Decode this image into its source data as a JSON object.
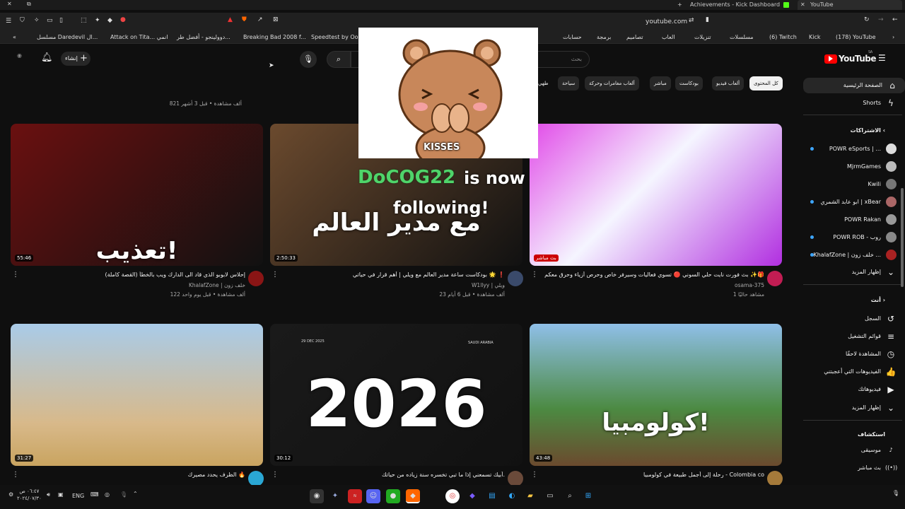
{
  "browser": {
    "tabs": [
      {
        "label": "Achievements - Kick Dashboard"
      },
      {
        "label": "YouTube"
      }
    ],
    "url": "youtube.com",
    "bookmarks": [
      "(178) YouTube",
      "Kick",
      "(6) Twitch",
      "مسلسلات",
      "تنزيلات",
      "العاب",
      "تصاميم",
      "برمجة",
      "حسابات",
      "Speedtest by Ookla",
      "Breaking Bad 2008 f...",
      "دوولينجو - أفضل طر...",
      "Attack on Tita... انمي",
      "مسلسل Daredevil ال..."
    ]
  },
  "header": {
    "logo": "YouTube",
    "logo_region": "SA",
    "search_placeholder": "بحث",
    "create_label": "إنشاء"
  },
  "chips": [
    "كل المحتوى",
    "ألعاب فيديو",
    "بودكاست",
    "مباشر",
    "ألعاب مغامرات وحركة",
    "سياحة",
    "طهي"
  ],
  "overlay": {
    "sticker_caption": "KISSES",
    "follow_name": "DoCOG22",
    "follow_text1": "is now",
    "follow_text2": "following!"
  },
  "sidebar": {
    "home": "الصفحة الرئيسية",
    "shorts": "Shorts",
    "subscriptions_title": "الاشتراكات",
    "subscriptions": [
      {
        "name": "POWR eSports | ...",
        "dot": true
      },
      {
        "name": "MjrmGames",
        "dot": false
      },
      {
        "name": "Kwili",
        "dot": false
      },
      {
        "name": "ابو عابد الشمري | xBear",
        "dot": true
      },
      {
        "name": "POWR Rakan",
        "dot": false
      },
      {
        "name": "POWR ROB - روب",
        "dot": true
      },
      {
        "name": "KhalafZone | خلف زون ...",
        "dot": true
      }
    ],
    "show_more": "إظهار المزيد",
    "you_title": "أنت",
    "you_items": [
      {
        "label": "السجل",
        "icon": "history-icon",
        "glyph": "↺"
      },
      {
        "label": "قوائم التشغيل",
        "icon": "playlists-icon",
        "glyph": "≡"
      },
      {
        "label": "المشاهدة لاحقًا",
        "icon": "clock-icon",
        "glyph": "◷"
      },
      {
        "label": "الفيديوهات التي أعجبتني",
        "icon": "like-icon",
        "glyph": "👍"
      },
      {
        "label": "فيديوهاتك",
        "icon": "your-videos-icon",
        "glyph": "▶"
      }
    ],
    "show_more2": "إظهار المزيد",
    "explore_title": "استكشاف",
    "explore_items": [
      {
        "label": "موسيقى",
        "icon": "music-icon",
        "glyph": "♪"
      },
      {
        "label": "بث مباشر",
        "icon": "live-icon",
        "glyph": "((•))"
      }
    ]
  },
  "top_meta": "821 ألف مشاهدة • قبل 3 أشهر",
  "videos": [
    {
      "title": "بث فورت نايت حلي السوني 🔴 تسوي فعاليات وسيرفر خاص وحرص أزياء وحرق معكم ✨🎁",
      "channel": "osama-375",
      "meta": "1 مشاهد حاليًا",
      "duration": "بث مباشر",
      "thumb_color": "#b23ad0",
      "avatar_color": "#c21d53"
    },
    {
      "title": "بودكاست ساعة مدير العالم مع ويلي | أهم قرار في حياتي 🌟 ❗",
      "channel": "W1llyy | ويلي",
      "meta": "23 ألف مشاهدة • قبل 6 أيام",
      "duration": "2:50:33",
      "thumb_color": "#6b4a2e",
      "avatar_color": "#3a4a6a",
      "thumb_text": "مع مدير العالم"
    },
    {
      "title": "إحلاس لابوبو الذي قاد الى الدارك ويب بالخطأ (القصة كاملة)",
      "channel": "KhalafZone | خلف زون",
      "meta": "122 ألف مشاهدة • قبل يوم واحد",
      "duration": "55:46",
      "thumb_color": "#6a1010",
      "avatar_color": "#8a1515",
      "thumb_text": "تعذيب!"
    },
    {
      "title": "رحلة إلى أجمل طبيعة في كولومبيا - Colombia co",
      "channel": "",
      "meta": "",
      "duration": "43:48",
      "thumb_color": "#3f7a3a",
      "avatar_color": "#a57a3a",
      "thumb_text": "كولومبيا!"
    },
    {
      "title": "أبيك تسمعني إذا ما تبي تخسره سنة زياده من حياتك.",
      "channel": "",
      "meta": "",
      "duration": "30:12",
      "thumb_color": "#1a1a1a",
      "avatar_color": "#6a4a3a",
      "thumb_text": "2026",
      "thumb_date": "29 DEC 2025",
      "thumb_place": "SAUDI ARABIA"
    },
    {
      "title": "الظرف يحدد مصيرك 🔥",
      "channel": "",
      "meta": "",
      "duration": "31:27",
      "thumb_color": "#7aa3c8",
      "avatar_color": "#2aa7d4"
    }
  ],
  "taskbar": {
    "lang": "ENG",
    "time": "٠٦:٤٧ ص",
    "date": "٢٠٢٤/٠٧/٣٠"
  }
}
